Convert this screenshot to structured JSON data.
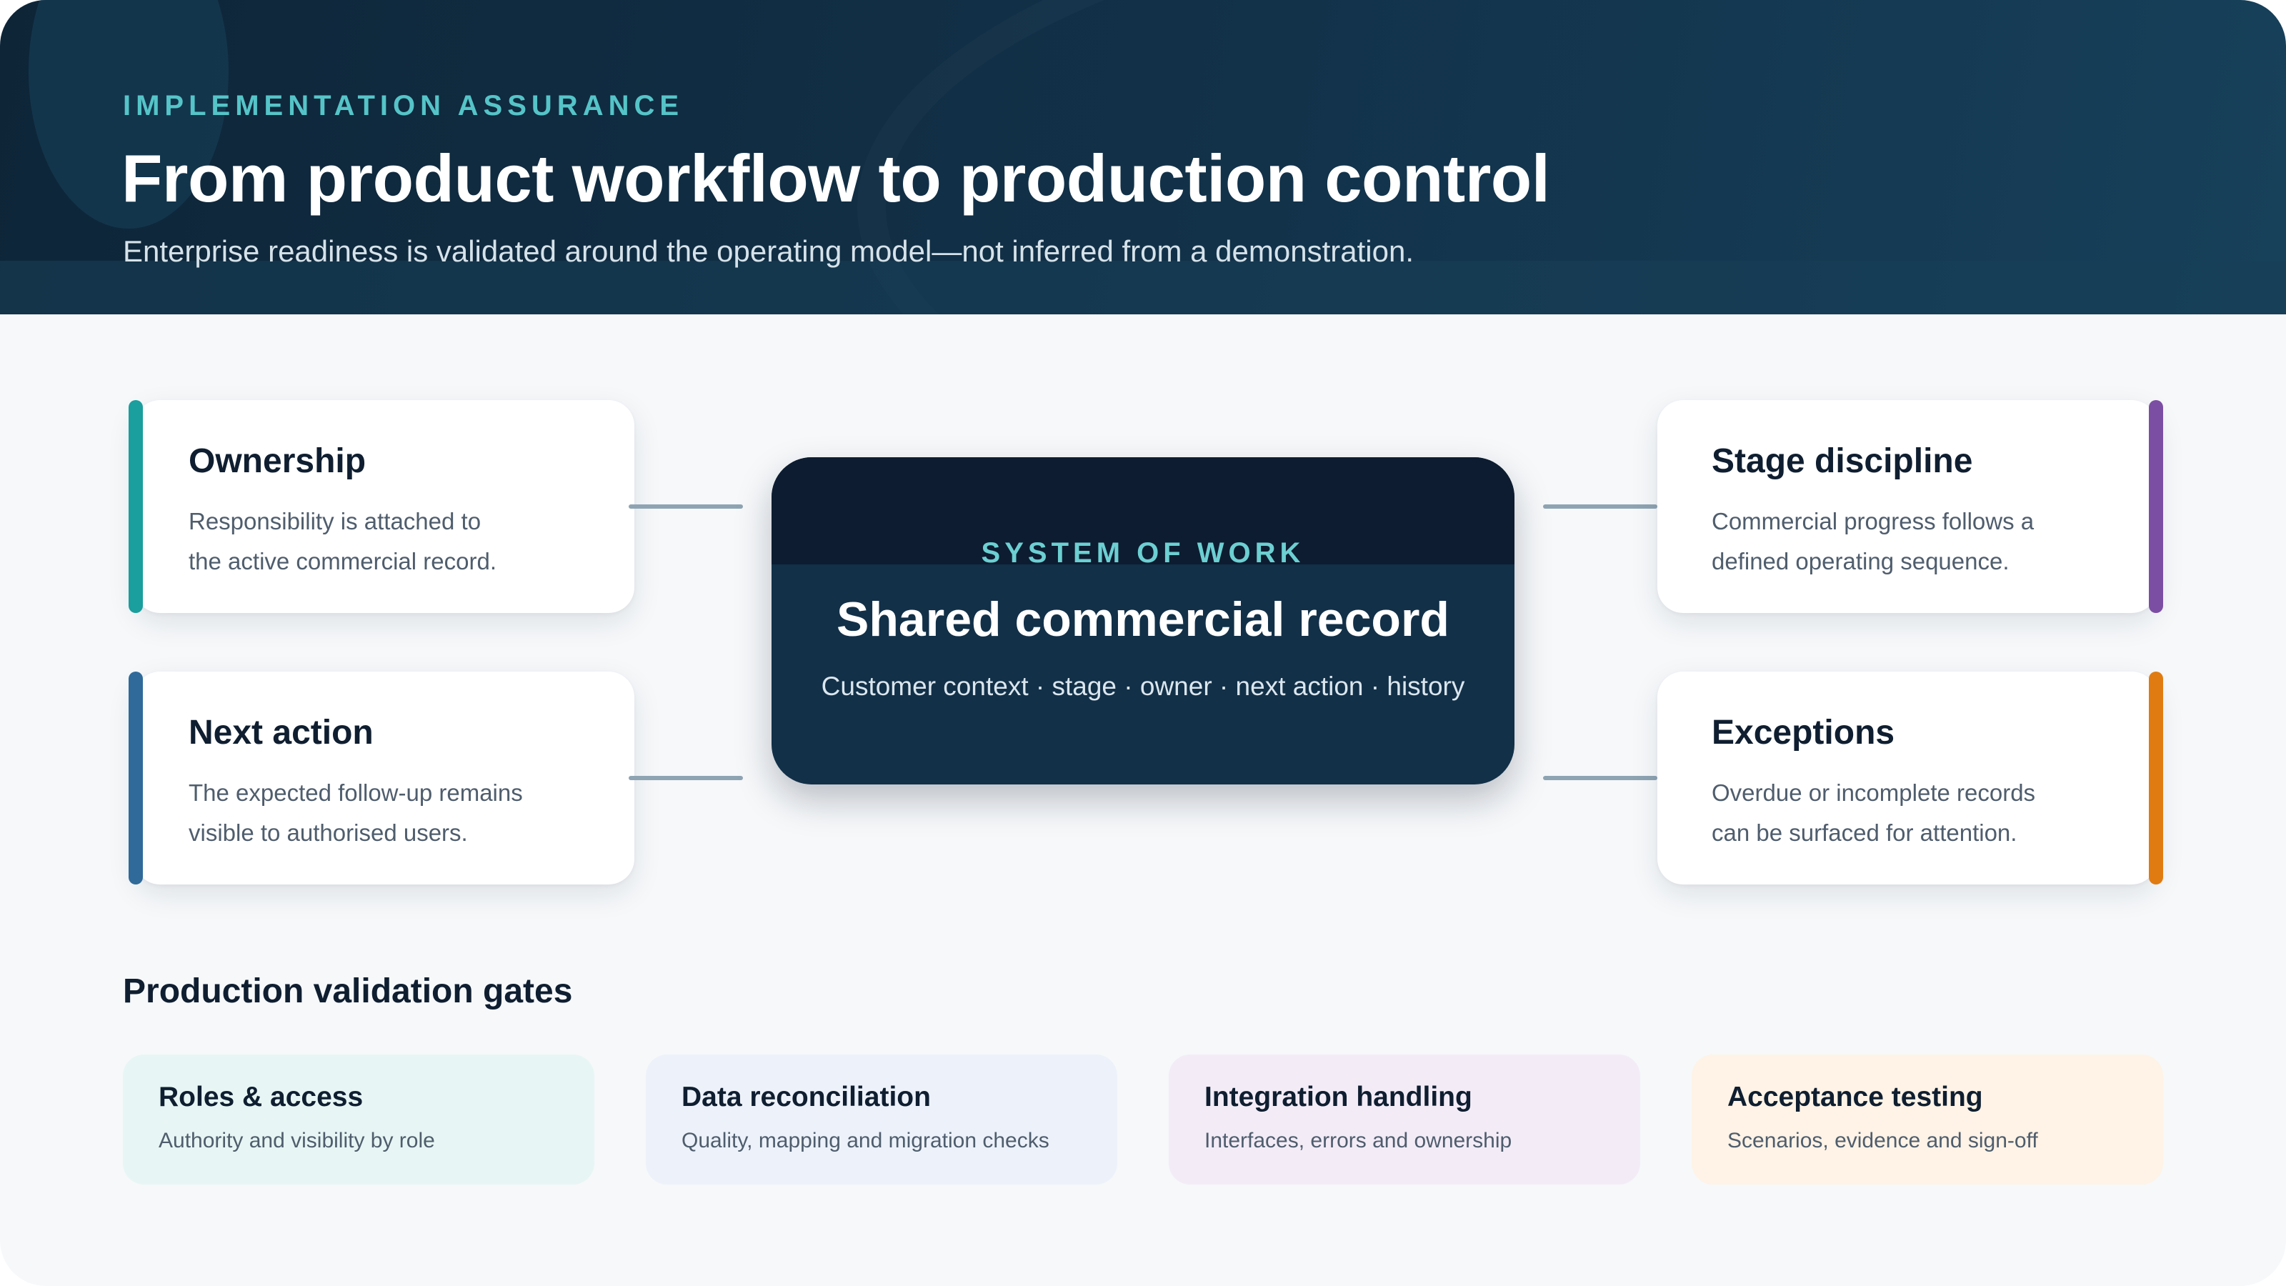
{
  "header": {
    "eyebrow": "IMPLEMENTATION ASSURANCE",
    "title": "From product workflow to production control",
    "subtitle": "Enterprise readiness is validated around the operating model—not inferred from a demonstration."
  },
  "center": {
    "eyebrow": "SYSTEM OF WORK",
    "title": "Shared commercial record",
    "subtitle": "Customer context · stage · owner · next action · history"
  },
  "cards": {
    "ownership": {
      "title": "Ownership",
      "line1": "Responsibility is attached to",
      "line2": "the active commercial record.",
      "accent": "#1a9e9e"
    },
    "next_action": {
      "title": "Next action",
      "line1": "The expected follow-up remains",
      "line2": "visible to authorised users.",
      "accent": "#2f6a9a"
    },
    "stage_discipline": {
      "title": "Stage discipline",
      "line1": "Commercial progress follows a",
      "line2": "defined operating sequence.",
      "accent": "#7b4ea3"
    },
    "exceptions": {
      "title": "Exceptions",
      "line1": "Overdue or incomplete records",
      "line2": "can be surfaced for attention.",
      "accent": "#e07b12"
    }
  },
  "gates": {
    "heading": "Production validation gates",
    "items": [
      {
        "title": "Roles & access",
        "desc": "Authority and visibility by role",
        "bg": "#e7f6f4"
      },
      {
        "title": "Data reconciliation",
        "desc": "Quality, mapping and migration checks",
        "bg": "#edf2fa"
      },
      {
        "title": "Integration handling",
        "desc": "Interfaces, errors and ownership",
        "bg": "#f3ecf7"
      },
      {
        "title": "Acceptance testing",
        "desc": "Scenarios, evidence and sign-off",
        "bg": "#fef3e6"
      }
    ]
  }
}
